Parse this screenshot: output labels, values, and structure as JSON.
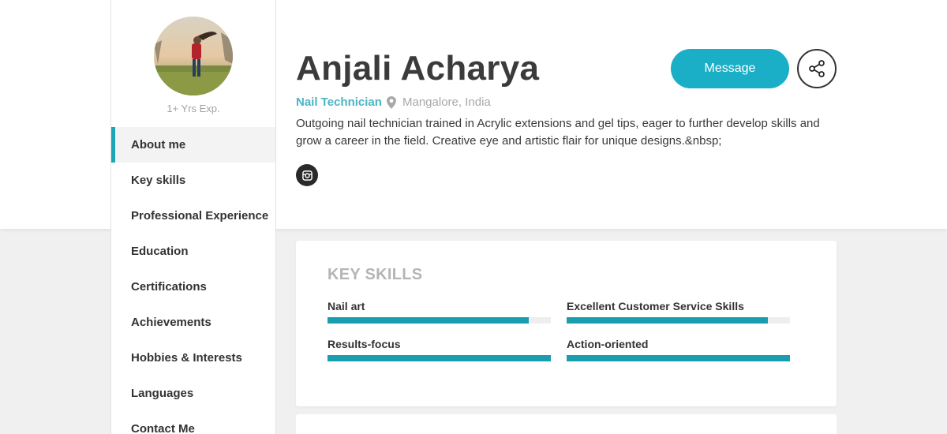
{
  "profile": {
    "name": "Anjali Acharya",
    "role": "Nail Technician",
    "location": "Mangalore, India",
    "experience": "1+ Yrs Exp.",
    "bio": "Outgoing nail technician trained in Acrylic extensions and gel tips, eager to further develop skills and grow a career in the field. Creative eye and artistic flair for unique designs.&nbsp;"
  },
  "actions": {
    "message_label": "Message"
  },
  "sidebar": {
    "items": [
      {
        "label": "About me",
        "active": true
      },
      {
        "label": "Key skills"
      },
      {
        "label": "Professional Experience"
      },
      {
        "label": "Education"
      },
      {
        "label": "Certifications"
      },
      {
        "label": "Achievements"
      },
      {
        "label": "Hobbies & Interests"
      },
      {
        "label": "Languages"
      },
      {
        "label": "Contact Me"
      }
    ]
  },
  "skills": {
    "title": "KEY SKILLS",
    "items": [
      {
        "name": "Nail art",
        "level": 0.9
      },
      {
        "name": "Excellent Customer Service Skills",
        "level": 0.9
      },
      {
        "name": "Results-focus",
        "level": 1.0
      },
      {
        "name": "Action-oriented",
        "level": 1.0
      }
    ]
  },
  "colors": {
    "accent": "#1aafc6",
    "bar": "#1a9daf",
    "role": "#4ab5c4"
  },
  "icons": [
    "location-pin-icon",
    "instagram-icon",
    "share-icon"
  ]
}
